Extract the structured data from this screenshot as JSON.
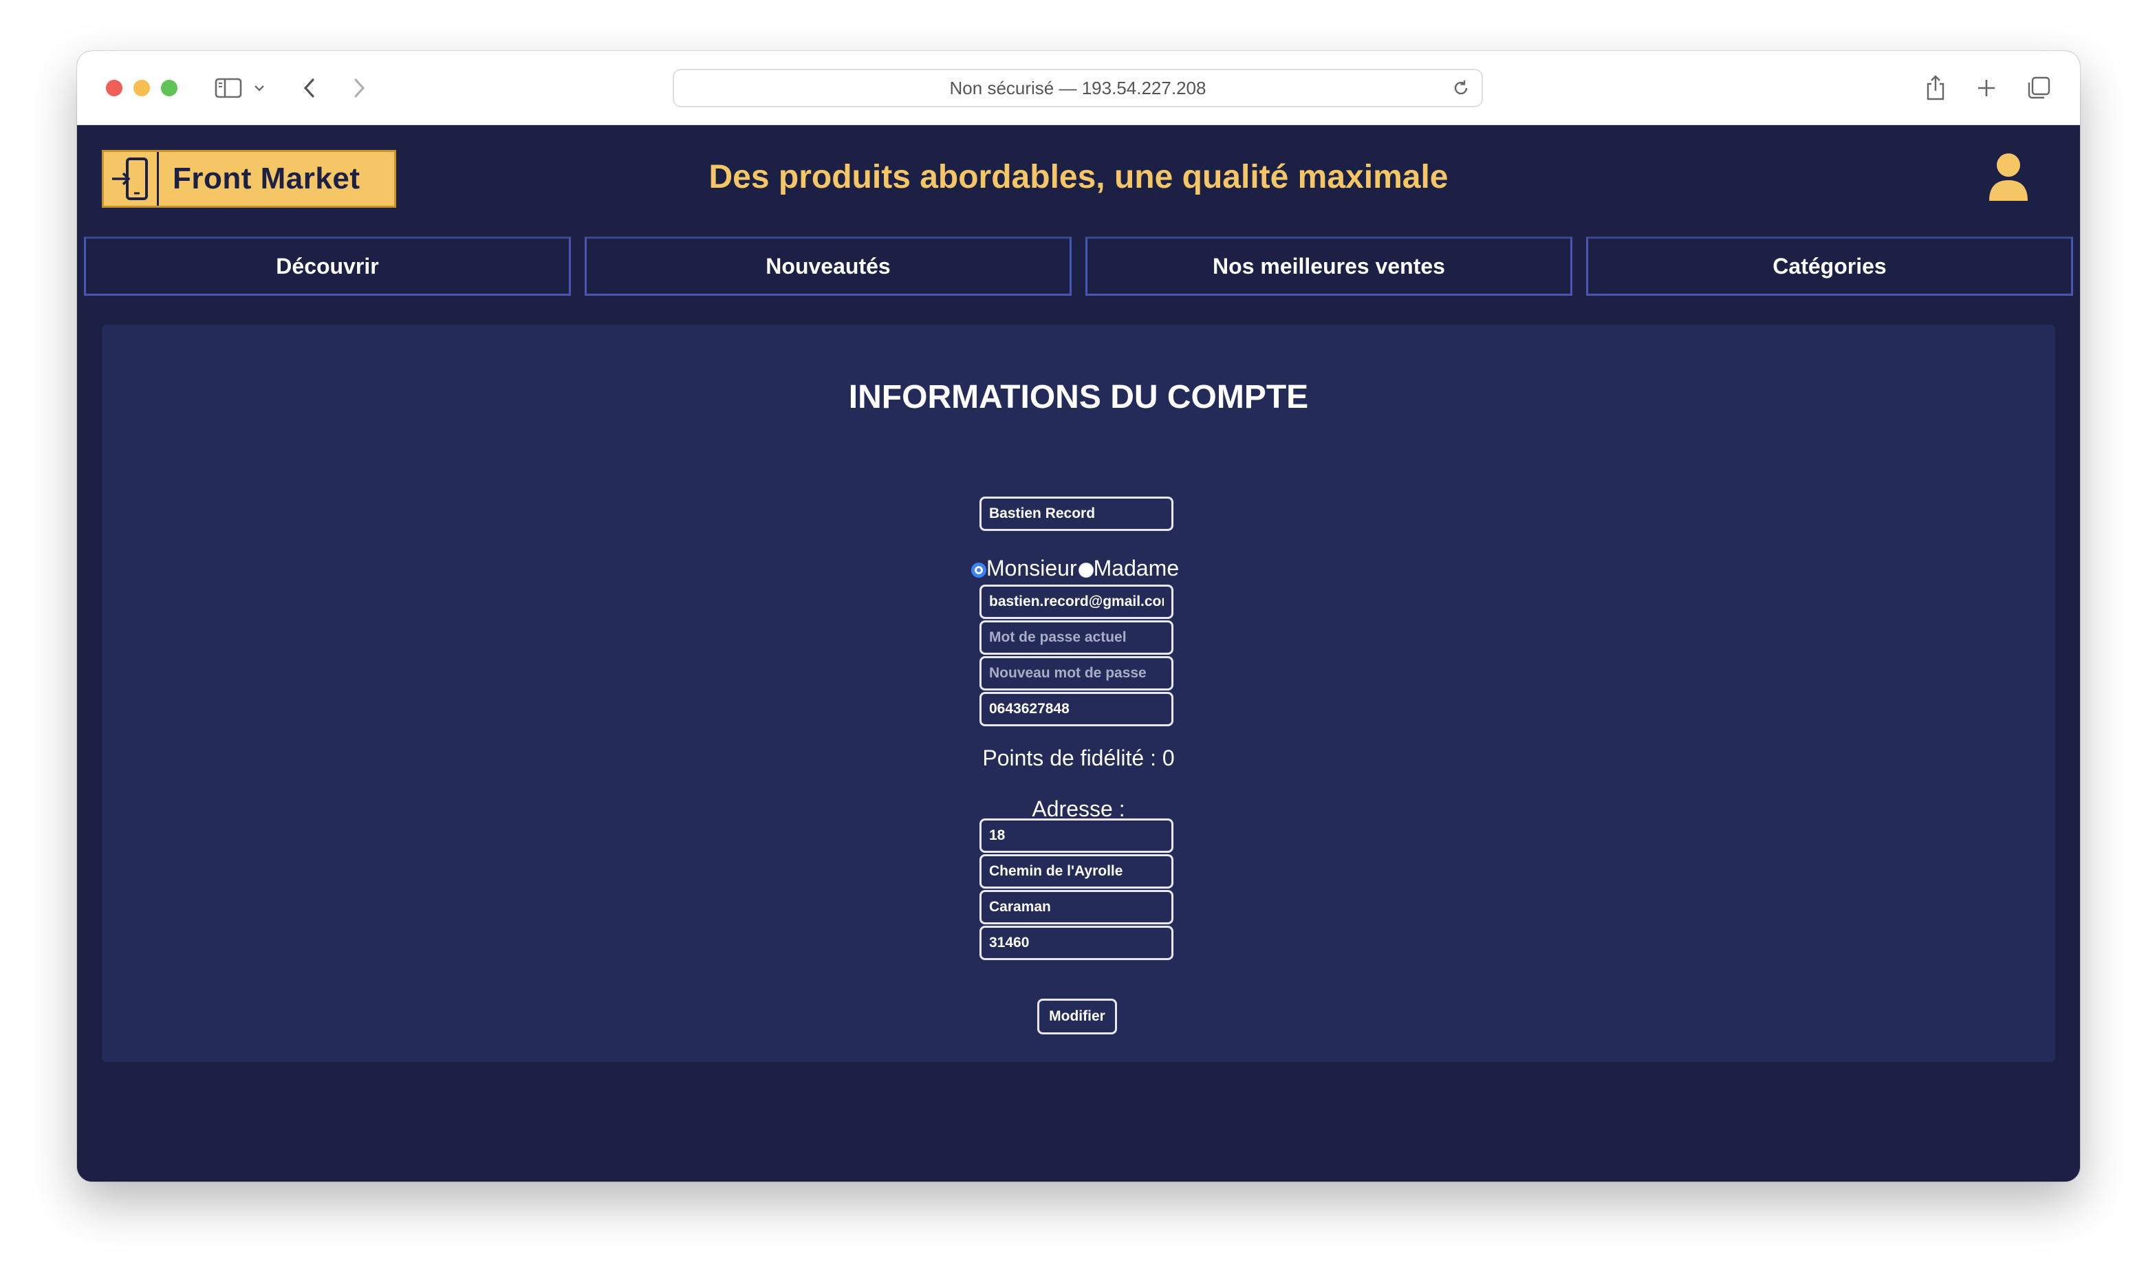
{
  "browser": {
    "address": "Non sécurisé — 193.54.227.208",
    "icons": {
      "sidebar": "sidebar-icon",
      "back": "chevron-left-icon",
      "forward": "chevron-right-icon",
      "reload": "reload-icon",
      "share": "share-icon",
      "new_tab": "plus-icon",
      "tabs": "tabs-overview-icon"
    }
  },
  "header": {
    "logo_text": "Front Market",
    "tagline": "Des produits abordables, une qualité maximale"
  },
  "nav": {
    "items": [
      "Découvrir",
      "Nouveautés",
      "Nos meilleures ventes",
      "Catégories"
    ]
  },
  "account": {
    "title": "INFORMATIONS DU COMPTE",
    "name": "Bastien Record",
    "gender_options": [
      "Monsieur",
      "Madame"
    ],
    "gender_selected": "Monsieur",
    "email": "bastien.record@gmail.com",
    "current_password_placeholder": "Mot de passe actuel",
    "new_password_placeholder": "Nouveau mot de passe",
    "phone": "0643627848",
    "loyalty_points": "Points de fidélité : 0",
    "address_label": "Adresse :",
    "address": {
      "number": "18",
      "street": "Chemin de l'Ayrolle",
      "city": "Caraman",
      "postal_code": "31460"
    },
    "submit_label": "Modifier"
  },
  "colors": {
    "background": "#1b2044",
    "panel": "#242b58",
    "accent": "#f5c666",
    "nav_border": "#4a56b0",
    "radio_selected": "#3b82f6"
  }
}
